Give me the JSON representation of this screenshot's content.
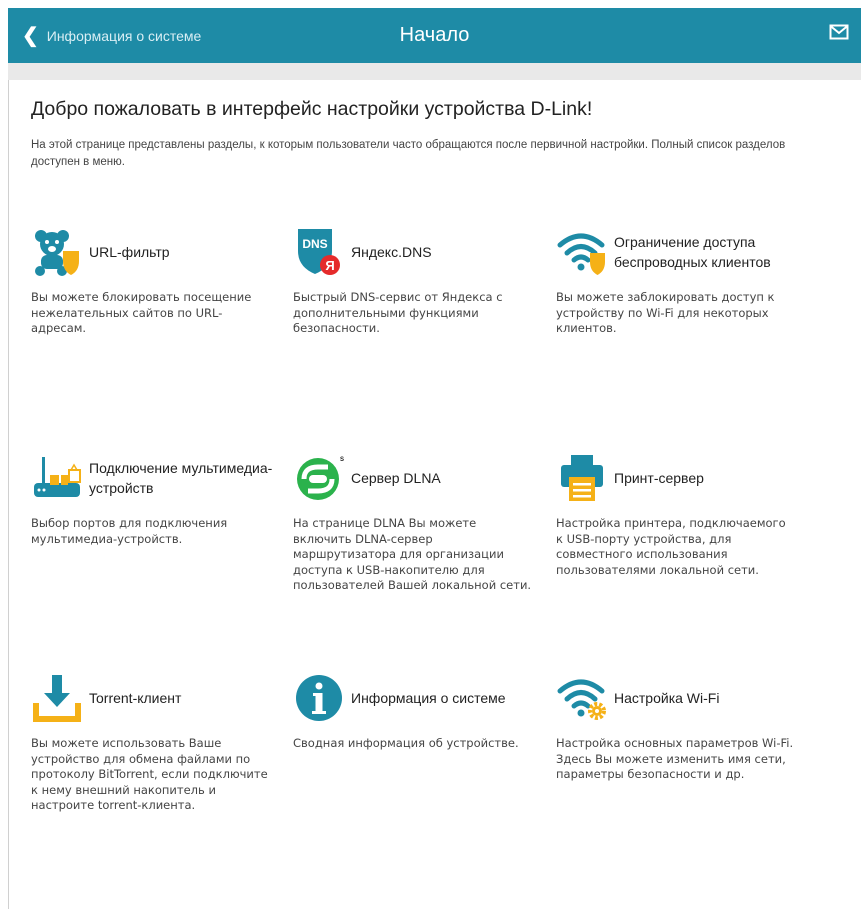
{
  "header": {
    "back_label": "Информация о системе",
    "title": "Начало",
    "accent_color": "#1e8ba6"
  },
  "main": {
    "heading": "Добро пожаловать в интерфейс настройки устройства D-Link!",
    "intro": "На этой странице представлены разделы, к которым пользователи часто обращаются после первичной настройки. Полный список разделов доступен в меню."
  },
  "tiles": [
    {
      "icon": "url-filter-icon",
      "title": "URL-фильтр",
      "description": "Вы можете блокировать посещение нежелательных сайтов по URL-адресам."
    },
    {
      "icon": "yandex-dns-icon",
      "title": "Яндекс.DNS",
      "description": "Быстрый DNS-сервис от Яндекса с дополнительными функциями безопасности."
    },
    {
      "icon": "wifi-shield-icon",
      "title": "Ограничение доступа беспроводных клиентов",
      "description": "Вы можете заблокировать доступ к устройству по Wi-Fi для некоторых клиентов."
    },
    {
      "icon": "multimedia-router-icon",
      "title": "Подключение мультимедиа-устройств",
      "description": "Выбор портов для подключения мультимедиа-устройств."
    },
    {
      "icon": "dlna-icon",
      "title": "Сервер DLNA",
      "description": "На странице DLNA Вы можете включить DLNA-сервер маршрутизатора для организации доступа к USB-накопителю для пользователей Вашей локальной сети."
    },
    {
      "icon": "printer-icon",
      "title": "Принт-сервер",
      "description": "Настройка принтера, подключаемого к USB-порту устройства, для совместного использования пользователями локальной сети."
    },
    {
      "icon": "download-icon",
      "title": "Torrent-клиент",
      "description": "Вы можете использовать Ваше устройство для обмена файлами по протоколу BitTorrent, если подключите к нему внешний накопитель и настроите torrent-клиента."
    },
    {
      "icon": "info-icon",
      "title": "Информация о системе",
      "description": "Сводная информация об устройстве."
    },
    {
      "icon": "wifi-gear-icon",
      "title": "Настройка Wi-Fi",
      "description": "Настройка основных параметров Wi-Fi. Здесь Вы можете изменить имя сети, параметры безопасности и др."
    }
  ]
}
